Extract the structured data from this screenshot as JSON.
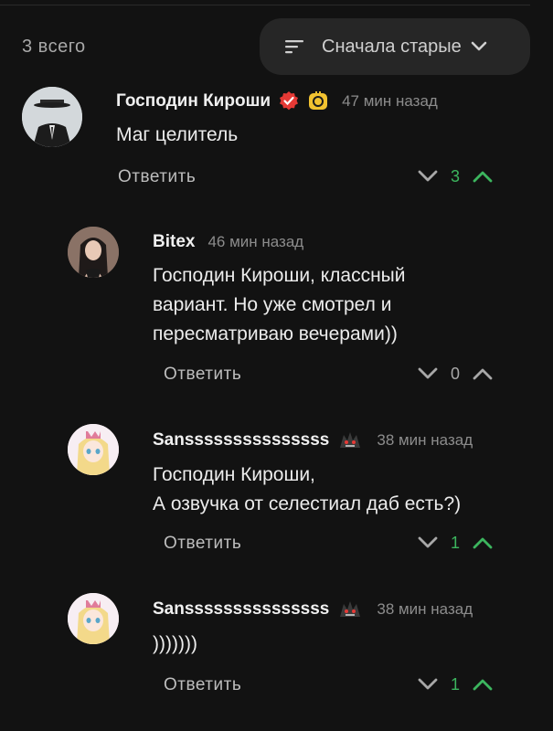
{
  "header": {
    "count_label": "3 всего",
    "sort_label": "Сначала старые"
  },
  "colors": {
    "background": "#121212",
    "upvote_active": "#3cb55e",
    "verified_badge": "#e53935",
    "level_badge": "#f2c230"
  },
  "comments": [
    {
      "author": "Господин Кироши",
      "time": "47 мин назад",
      "text": "Маг целитель",
      "reply_label": "Ответить",
      "score": "3",
      "badges": [
        "verified-icon",
        "level-badge-icon"
      ],
      "avatar": "man-in-suit-hat-avatar"
    },
    {
      "author": "Bitex",
      "time": "46 мин назад",
      "text": "Господин Кироши, классный\nвариант. Но уже смотрел и\nпересматриваю вечерами))",
      "reply_label": "Ответить",
      "score": "0",
      "avatar": "anime-girl-dark-hair-avatar"
    },
    {
      "author": "Sansssssssssssssss",
      "time": "38 мин назад",
      "text": "Господин Кироши,\nА озвучка от селестиал даб есть?)",
      "reply_label": "Ответить",
      "score": "1",
      "badges": [
        "creature-badge-icon"
      ],
      "avatar": "anime-girl-blonde-avatar"
    },
    {
      "author": "Sansssssssssssssss",
      "time": "38 мин назад",
      "text": ")))))))",
      "reply_label": "Ответить",
      "score": "1",
      "badges": [
        "creature-badge-icon"
      ],
      "avatar": "anime-girl-blonde-avatar"
    }
  ]
}
